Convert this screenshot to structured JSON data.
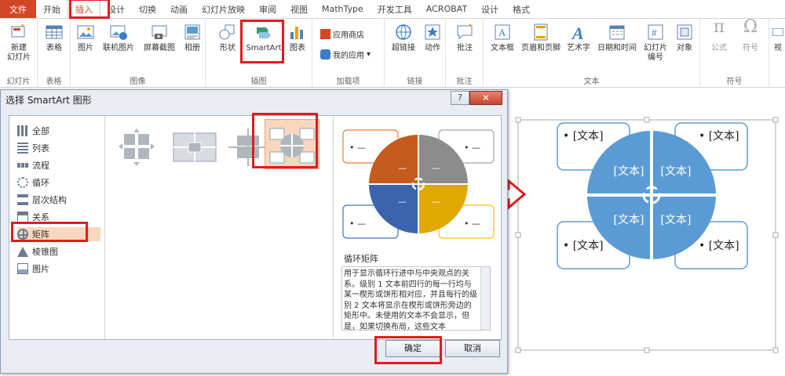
{
  "tabs": [
    "文件",
    "开始",
    "插入",
    "设计",
    "切换",
    "动画",
    "幻灯片放映",
    "审阅",
    "视图",
    "MathType",
    "开发工具",
    "ACROBAT",
    "设计",
    "格式"
  ],
  "ribbon": {
    "slides": {
      "new_slide": "新建",
      "new_slide2": "幻灯片",
      "group": "幻灯片"
    },
    "tables": {
      "table": "表格",
      "group": "表格"
    },
    "images": {
      "picture": "图片",
      "online_picture": "联机图片",
      "screenshot": "屏幕截图",
      "album": "相册",
      "group": "图像"
    },
    "illustrations": {
      "shapes": "形状",
      "smartart": "SmartArt",
      "chart": "图表",
      "group": "插图"
    },
    "addins": {
      "store": "应用商店",
      "my_apps": "我的应用",
      "group": "加载项"
    },
    "links": {
      "hyperlink": "超链接",
      "action": "动作",
      "group": "链接"
    },
    "comments": {
      "comment": "批注",
      "group": "批注"
    },
    "text": {
      "textbox": "文本框",
      "header_footer": "页眉和页脚",
      "wordart": "艺术字",
      "datetime": "日期和时间",
      "slide_number": "幻灯片",
      "slide_number2": "编号",
      "object": "对象",
      "group": "文本"
    },
    "symbols": {
      "equation": "公式",
      "symbol": "符号",
      "group": "符号"
    },
    "media": {
      "video": "视"
    }
  },
  "dialog": {
    "title": "选择 SmartArt 图形",
    "help": "?",
    "close": "✕",
    "categories": [
      "全部",
      "列表",
      "流程",
      "循环",
      "层次结构",
      "关系",
      "矩阵",
      "棱锥图",
      "图片"
    ],
    "selected_category": "矩阵",
    "preview_title": "循环矩阵",
    "preview_bullets": [
      "• —",
      "• —",
      "• —",
      "• —"
    ],
    "preview_quadrant_text": "—",
    "preview_description": "用于显示循环行进中与中央观点的关系。级别 1 文本前四行的每一行均与某一楔形或饼形相对应，并且每行的级别 2 文本将显示在楔形或饼形旁边的矩形中。未使用的文本不会显示，但是，如果切换布局，这些文本",
    "ok": "确定",
    "cancel": "取消"
  },
  "slide": {
    "bullet_text": "• [文本]",
    "quadrant_text": "[文本]"
  },
  "colors": {
    "accent": "#d24726",
    "highlight": "#e21b1b",
    "smart_blue": "#5b9bd5"
  }
}
